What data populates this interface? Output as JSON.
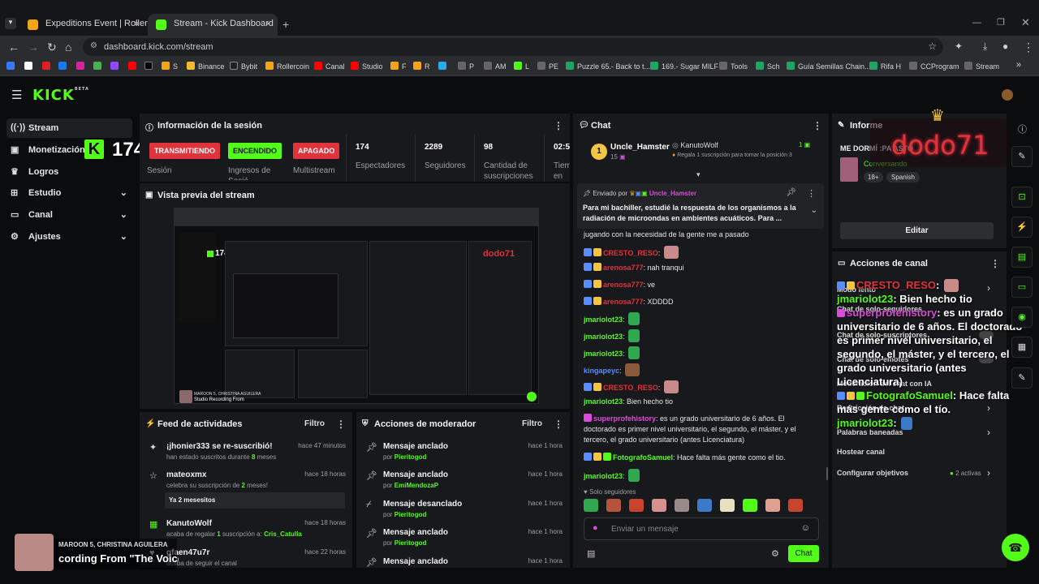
{
  "browser": {
    "tabs": [
      {
        "title": "Expeditions Event | RollerCoin",
        "active": false
      },
      {
        "title": "Stream - Kick Dashboard",
        "active": true
      }
    ],
    "new_tab": "+",
    "url": "dashboard.kick.com/stream",
    "bookmarks": [
      "S",
      "Binance",
      "Bybit",
      "Rollercoin",
      "Canal",
      "Studio",
      "F",
      "R",
      "P",
      "AM",
      "L",
      "PE",
      "Puzzle 65.- Back to t...",
      "169.- Sugar MILF",
      "Tools",
      "Sch",
      "Guía Semillas Chain...",
      "Rifa H",
      "CCProgram",
      "Stream"
    ]
  },
  "app": {
    "logo": "KICK",
    "logo_sup": "BETA",
    "overlay_count": "174"
  },
  "sidebar": {
    "items": [
      {
        "label": "Stream",
        "icon": "broadcast-icon",
        "active": true
      },
      {
        "label": "Monetización",
        "icon": "dollar-icon"
      },
      {
        "label": "Logros",
        "icon": "trophy-icon"
      },
      {
        "label": "Estudio",
        "icon": "studio-icon"
      },
      {
        "label": "Canal",
        "icon": "channel-icon"
      },
      {
        "label": "Ajustes",
        "icon": "gear-icon"
      }
    ]
  },
  "session": {
    "title": "Información de la sesión",
    "status_live": "TRANSMITIENDO",
    "status_live_label": "Sesión",
    "income_on": "ENCENDIDO",
    "income_label": "Ingresos de Sesió",
    "multistream": "APAGADO",
    "multistream_label": "Multistream",
    "viewers": "174",
    "viewers_label": "Espectadores",
    "followers": "2289",
    "followers_label": "Seguidores",
    "subs": "98",
    "subs_label": "Cantidad de suscripciones",
    "time": "02:5",
    "time_label": "Tiem en vi"
  },
  "preview": {
    "title": "Vista previa del stream",
    "mini_count": "174",
    "mini_overlay": "dodo71",
    "music_artist": "MAROON 5, CHRISTINA AGUILERA",
    "music_title": "Studio Recording From"
  },
  "feed": {
    "title": "Feed de actividades",
    "filter": "Filtro",
    "items": [
      {
        "title": "¡jhonier333 se re-suscribió!",
        "sub_pre": "han estado suscritos durante ",
        "sub_hl": "8",
        "sub_post": " meses",
        "time": "hace 47 minutos",
        "icon": "sparkle-icon"
      },
      {
        "title": "mateoxmx",
        "sub_pre": "celebra su suscripción de ",
        "sub_hl": "2",
        "sub_post": " meses!",
        "time": "hace 18 horas",
        "icon": "star-icon",
        "message": "Ya 2 mesesitos"
      },
      {
        "title": "KanutoWolf",
        "sub_pre": "acaba de regalar ",
        "sub_hl": "1",
        "sub_post": " suscripción a: ",
        "sub_user": "Cris_Catulla",
        "time": "hace 18 horas",
        "icon": "gift-icon"
      },
      {
        "title": "gfaen47u7r",
        "sub_pre": "acaba de seguir el canal",
        "time": "hace 22 horas",
        "icon": "heart-icon"
      }
    ]
  },
  "mod": {
    "title": "Acciones de moderador",
    "filter": "Filtro",
    "items": [
      {
        "title": "Mensaje anclado",
        "by": "por",
        "user": "Pieritogod",
        "time": "hace 1 hora",
        "icon": "pin-icon"
      },
      {
        "title": "Mensaje anclado",
        "by": "por",
        "user": "EmiMendozaP",
        "time": "hace 1 hora",
        "icon": "pin-icon"
      },
      {
        "title": "Mensaje desanclado",
        "by": "por",
        "user": "Pieritogod",
        "time": "hace 1 hora",
        "icon": "unpin-icon"
      },
      {
        "title": "Mensaje anclado",
        "by": "por",
        "user": "Pieritogod",
        "time": "hace 1 hora",
        "icon": "pin-icon"
      },
      {
        "title": "Mensaje anclado",
        "by": "",
        "user": "",
        "time": "hace 1 hora",
        "icon": "pin-icon"
      }
    ]
  },
  "chat": {
    "title": "Chat",
    "top_gifter": {
      "rank": "1",
      "name": "Uncle_Hamster",
      "count": "15"
    },
    "gift_event": {
      "name": "KanutoWolf",
      "text": "Regala 1 suscripción para tomar la posición 3",
      "count": "1"
    },
    "pinned": {
      "by_label": "Enviado por",
      "user": "Uncle_Hamster",
      "text": "Para mi bachiller, estudié la respuesta de los organismos a la radiación de microondas en ambientes acuáticos. Para ..."
    },
    "messages": [
      {
        "user": "",
        "text": "jugando con la necesidad de la gente me a pasado"
      },
      {
        "user": "CRESTO_RESO",
        "color": "red",
        "text": ""
      },
      {
        "user": "arenosa777",
        "color": "red",
        "text": ": nah tranqui"
      },
      {
        "user": "arenosa777",
        "color": "red",
        "text": ": ve"
      },
      {
        "user": "arenosa777",
        "color": "red",
        "text": ": XDDDD"
      },
      {
        "user": "jmariolot23",
        "color": "green",
        "text": ":"
      },
      {
        "user": "jmariolot23",
        "color": "green",
        "text": ":"
      },
      {
        "user": "jmariolot23",
        "color": "green",
        "text": ":"
      },
      {
        "user": "kingapeyc",
        "color": "blue",
        "text": ":"
      },
      {
        "user": "CRESTO_RESO",
        "color": "red",
        "text": ":"
      },
      {
        "user": "jmariolot23",
        "color": "green",
        "text": ": Bien hecho tio"
      },
      {
        "user": "superprofehistory",
        "color": "pink",
        "text": ": es un grado universitario de 6 años. El doctorado es primer nivel universitario, el segundo, el máster, y el tercero, el grado universitario (antes Licenciatura)"
      },
      {
        "user": "FotografoSamuel",
        "color": "green",
        "text": ": Hace falta más gente como el tio."
      },
      {
        "user": "jmariolot23",
        "color": "green",
        "text": ":"
      }
    ],
    "followers_only": "Solo seguidores",
    "input_placeholder": "Enviar un mensaje",
    "send": "Chat"
  },
  "info": {
    "title": "Informe",
    "stream_title": "ME DORMÍ :PA ASTO",
    "category": "Conversando",
    "age": "18+",
    "language": "Spanish",
    "edit": "Editar",
    "overlay_name": "dodo71"
  },
  "channel": {
    "title": "Acciones de canal",
    "items": [
      {
        "label": "Modo lento"
      },
      {
        "label": "Chat de solo-seguidores"
      },
      {
        "label": "Chat de solo-suscriptores"
      },
      {
        "label": "Chat de solo-emotes"
      },
      {
        "label": "Moderación del chat con IA"
      },
      {
        "label": "Restricción de chat"
      },
      {
        "label": "Palabras baneadas"
      },
      {
        "label": "Hostear canal"
      },
      {
        "label": "Configurar objetivos",
        "status": "2 activas"
      }
    ]
  },
  "overlay_chat": [
    {
      "user": "CRESTO_RESO",
      "text": ":"
    },
    {
      "user": "jmariolot23",
      "text": ": Bien hecho tio"
    },
    {
      "user": "superprofehistory",
      "text": ": es un grado universitario de 6 años. El doctorado es primer nivel universitario, el segundo, el máster, y el tercero, el grado universitario (antes Licenciatura)"
    },
    {
      "user": "FotografoSamuel",
      "text": ": Hace falta más gente como el tío."
    },
    {
      "user": "jmariolot23",
      "text": ":"
    }
  ],
  "music": {
    "artist": "MAROON 5, CHRISTINA AGUILERA",
    "title": "cording From \"The Voice"
  },
  "colors": {
    "accent": "#53fc18",
    "live": "#e0333b",
    "bg": "#0b0c0e",
    "panel": "#18191c"
  }
}
